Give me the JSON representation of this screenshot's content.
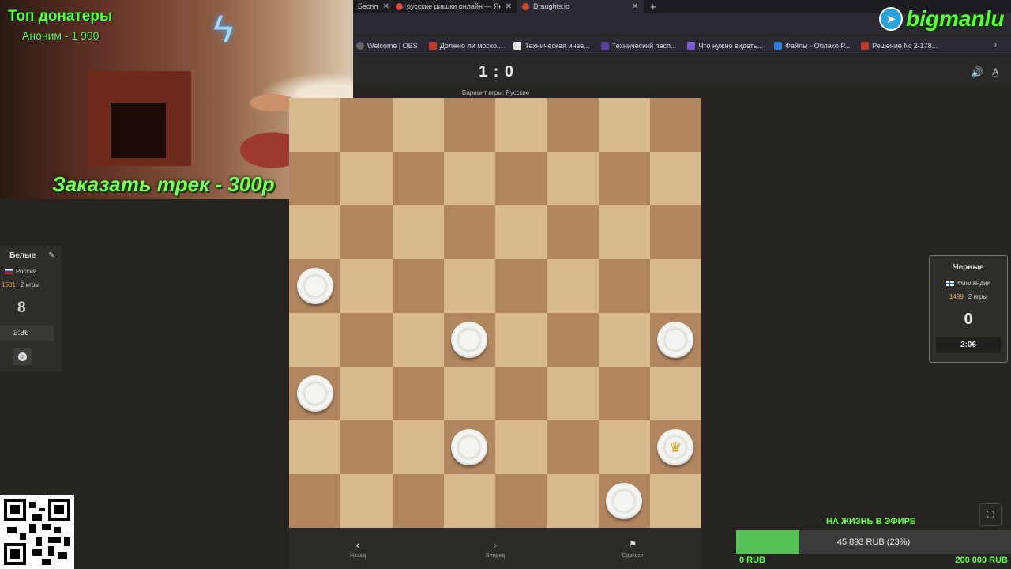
{
  "browser": {
    "tabs": [
      {
        "label": "Беспл",
        "fav": "#555",
        "closable": true
      },
      {
        "label": "русские шашки онлайн — Яндекс",
        "fav": "#e24a3b",
        "closable": true
      },
      {
        "label": "Draughts.io",
        "fav": "#d3462c",
        "closable": true,
        "active": true
      }
    ],
    "bookmarks": [
      {
        "label": "Welcome | OBS",
        "color": "#666"
      },
      {
        "label": "Должно ли моско...",
        "color": "#c0392b"
      },
      {
        "label": "Техническая инве...",
        "color": "#e8e8e8"
      },
      {
        "label": "Технический пасп...",
        "color": "#5b3fa0"
      },
      {
        "label": "Что нужно видеть...",
        "color": "#7d5bd6"
      },
      {
        "label": "Файлы - Облако Р...",
        "color": "#2f7fd8"
      },
      {
        "label": "Решение № 2-178...",
        "color": "#c0392b"
      }
    ]
  },
  "game": {
    "score": "1 : 0",
    "variant": "Вариант игры: Русские",
    "board": {
      "light": "#d8b88e",
      "dark": "#b08660",
      "pieces": [
        {
          "col": 0,
          "row": 3,
          "king": false
        },
        {
          "col": 3,
          "row": 4,
          "king": false
        },
        {
          "col": 7,
          "row": 4,
          "king": false
        },
        {
          "col": 0,
          "row": 5,
          "king": false
        },
        {
          "col": 3,
          "row": 6,
          "king": false
        },
        {
          "col": 7,
          "row": 6,
          "king": true
        },
        {
          "col": 6,
          "row": 7,
          "king": false
        }
      ]
    },
    "controls": {
      "back": "Назад",
      "forward": "Вперед",
      "resign": "Сдаться"
    }
  },
  "white_player": {
    "name": "Белые",
    "country": "Россия",
    "rating": "1501",
    "games": "2 игры",
    "count": "8",
    "timer": "2:36"
  },
  "black_player": {
    "name": "Черные",
    "country": "Финляндия",
    "rating": "1499",
    "games": "2 игры",
    "count": "0",
    "timer": "2:06"
  },
  "stream": {
    "donors_title": "Топ донатеры",
    "top_donor": "Аноним - 1 900",
    "order_track": "Заказать трек - 300р",
    "brand": "bigmanlu",
    "goal": {
      "title": "НА ЖИЗНЬ В ЭФИРЕ",
      "current": "45 893 RUB (23%)",
      "fraction": 0.23,
      "min": "0 RUB",
      "max": "200 000 RUB"
    }
  }
}
